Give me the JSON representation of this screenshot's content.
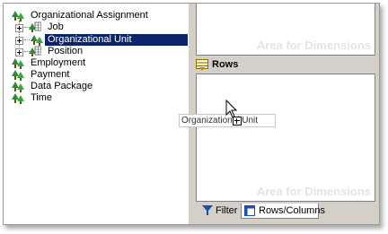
{
  "tree": {
    "items": [
      {
        "label": "Organizational Assignment",
        "icon": "green-tree-icon"
      },
      {
        "label": "Job",
        "icon": "grid-tree-icon"
      },
      {
        "label": "Organizational Unit",
        "icon": "green-tree-icon",
        "selected": true
      },
      {
        "label": "Position",
        "icon": "grid-tree-icon"
      },
      {
        "label": "Employment",
        "icon": "green-tree-icon"
      },
      {
        "label": "Payment",
        "icon": "green-tree-icon"
      },
      {
        "label": "Data Package",
        "icon": "green-tree-icon"
      },
      {
        "label": "Time",
        "icon": "green-tree-icon"
      }
    ]
  },
  "areas": {
    "columns_watermark": "Area for Dimensions",
    "rows_header": "Rows",
    "rows_watermark": "Area for Dimensions"
  },
  "tabs": [
    {
      "label": "Filter",
      "icon": "filter-funnel-icon"
    },
    {
      "label": "Rows/Columns",
      "icon": "rows-columns-icon",
      "active": true
    }
  ],
  "drag": {
    "label": "Organizational Unit",
    "badge": "+"
  },
  "colors": {
    "selection": "#0a246a",
    "panel": "#d4d0c8",
    "tree_green": "#2e8b2e"
  }
}
